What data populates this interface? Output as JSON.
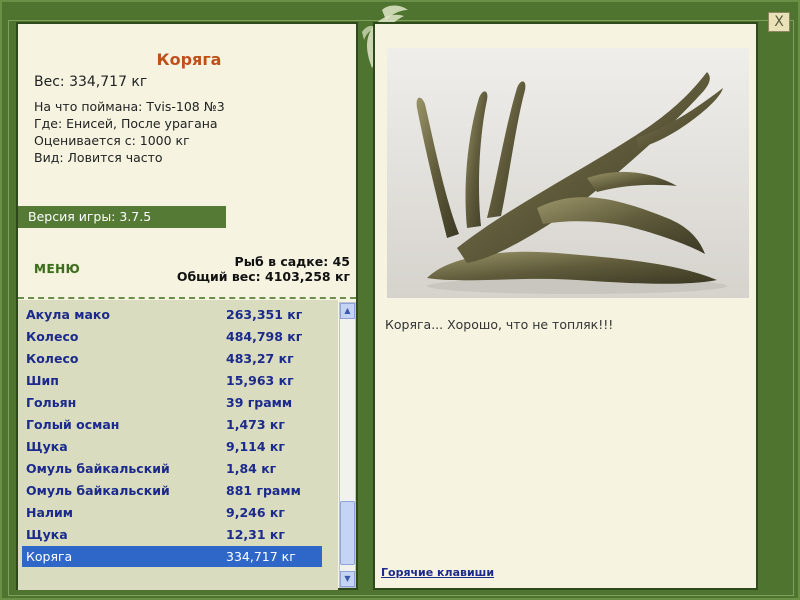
{
  "close_label": "X",
  "fish": {
    "title": "Коряга",
    "weight": "Вес: 334,717 кг",
    "caught_with": "На что поймана: Tvis-108 №3",
    "location": "Где: Енисей, После урагана",
    "valued_from": "Оценивается с: 1000 кг",
    "frequency": "Вид: Ловится часто",
    "description": "Коряга... Хорошо, что не топляк!!!"
  },
  "version": "Версия игры: 3.7.5",
  "menu_label": "МЕНЮ",
  "stats": {
    "fish_count": "Рыб в садке: 45",
    "total_weight": "Общий вес: 4103,258 кг"
  },
  "catch_list": [
    {
      "name": "Акула мако",
      "weight": "263,351 кг"
    },
    {
      "name": "Колесо",
      "weight": "484,798 кг"
    },
    {
      "name": "Колесо",
      "weight": "483,27 кг"
    },
    {
      "name": "Шип",
      "weight": "15,963 кг"
    },
    {
      "name": "Гольян",
      "weight": "39 грамм"
    },
    {
      "name": "Голый осман",
      "weight": "1,473 кг"
    },
    {
      "name": "Щука",
      "weight": "9,114 кг"
    },
    {
      "name": "Омуль байкальский",
      "weight": "1,84 кг"
    },
    {
      "name": "Омуль байкальский",
      "weight": "881 грамм"
    },
    {
      "name": "Налим",
      "weight": "9,246 кг"
    },
    {
      "name": "Щука",
      "weight": "12,31 кг"
    },
    {
      "name": "Коряга",
      "weight": "334,717 кг"
    }
  ],
  "hotkeys_label": "Горячие клавиши",
  "colors": {
    "frame": "#4f7430",
    "panel": "#f6f4e1",
    "title": "#c0501a",
    "list_text": "#1c2a8c",
    "selected": "#2f67c8"
  }
}
